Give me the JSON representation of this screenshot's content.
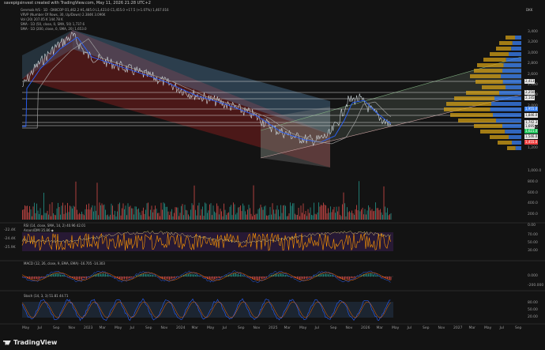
{
  "header": {
    "attribution": "savepigsinvest created with TradingView.com, May 11, 2026 21:28 UTC+2",
    "currency": "DKK"
  },
  "indicator_lines": [
    "Genmab A/S · 1D · DKKCOP  O1,462.2  H1,485.0  L1,423.0  C1,455.0  +17.5 (+1.07%)  1,467.016",
    "VRVP (Number Of Rows, 30, Up/Down)  2.384K  3.096K",
    "Vol (20)  207.05 K  144.78 K",
    "SMA · 1D (50, close, 0, SMA, 50)  1,737.6",
    "SMA · 1D (200, close, 0, SMA, 20)  1,653.0"
  ],
  "panes": {
    "rsi_label": "RSI (14, close, SMA, 14, 2)  40.96  42.01",
    "rsi_sub": "Aroon/DMI  35.86 ◆",
    "macd_label": "MACD (12, 26, close, 9, EMA, EMA)  -16.705  -14.303",
    "stoch_label": "Stoch (14, 3, 3)  51.81  44.71"
  },
  "price_axis": {
    "ticks": [
      "3,400",
      "3,200",
      "3,000",
      "2,800",
      "2,600",
      "2,400",
      "2,200",
      "2,000",
      "1,800",
      "1,600",
      "1,400",
      "1,200"
    ],
    "tags": [
      {
        "label": "2,413",
        "color": "#e6e6e6"
      },
      {
        "label": "2,250",
        "color": "#e6e6e6"
      },
      {
        "label": "2,145",
        "color": "#e6e6e6"
      },
      {
        "label": "1,955.0",
        "color": "#3b82f6"
      },
      {
        "label": "1,846.0",
        "color": "#e6e6e6"
      },
      {
        "label": "1,742.3",
        "color": "#e6e6e6"
      },
      {
        "label": "1,695",
        "color": "#e6e6e6"
      },
      {
        "label": "1,621.0",
        "color": "#22c55e"
      },
      {
        "label": "1,546.0",
        "color": "#e6e6e6"
      },
      {
        "label": "1,455.0",
        "color": "#ef4444"
      }
    ]
  },
  "volume_axis": [
    "1,000.0",
    "800.0",
    "600.0",
    "400.0",
    "200.0",
    "0.00"
  ],
  "rsi_axis": [
    "-22.4K",
    "-24.4K",
    "-25.9K"
  ],
  "rsi_right_axis": [
    "70.00",
    "50.00",
    "30.00"
  ],
  "macd_axis": [
    "0.000",
    "-200.000"
  ],
  "stoch_axis": [
    "80.00",
    "50.00",
    "20.00"
  ],
  "time_axis": [
    "May",
    "Jul",
    "Sep",
    "Nov",
    "2023",
    "Mar",
    "May",
    "Jul",
    "Sep",
    "Nov",
    "2024",
    "Mar",
    "May",
    "Jul",
    "Sep",
    "Nov",
    "2025",
    "Mar",
    "May",
    "Jul",
    "Sep",
    "Nov",
    "2026",
    "Mar",
    "May",
    "Jul",
    "Sep",
    "Nov",
    "2027",
    "Mar",
    "May",
    "Jul",
    "Sep"
  ],
  "brand": "TradingView",
  "colors": {
    "up": "#26a69a",
    "down": "#ef5350",
    "sma50": "#2962ff",
    "sma200": "#9e9e9e",
    "rsi": "#ff9800",
    "channelRed": "#b22222",
    "channelBlue": "#5b8fb9"
  }
}
